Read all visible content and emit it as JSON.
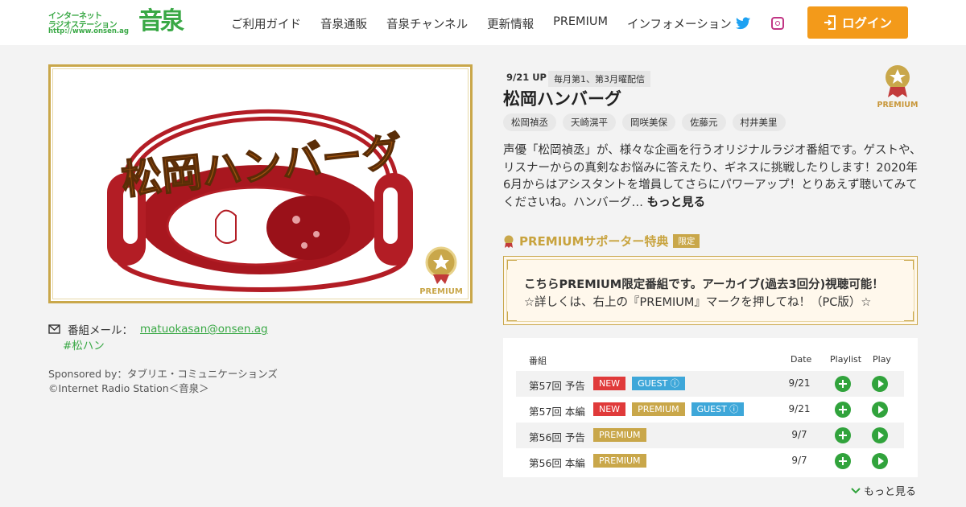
{
  "header": {
    "logo_line1": "インターネット",
    "logo_line2": "ラジオステーション",
    "logo_url": "http://www.onsen.ag",
    "logo_big": "音泉",
    "nav": [
      "ご利用ガイド",
      "音泉通販",
      "音泉チャンネル",
      "更新情報",
      "PREMIUM",
      "インフォメーション"
    ],
    "login_label": "ログイン"
  },
  "program": {
    "art_title": "松岡ハンバーグ",
    "art_badge": "PREMIUM",
    "mail_label": "番組メール：",
    "mail": "matuokasan@onsen.ag",
    "hashtag": "#松ハン",
    "sponsor": "Sponsored by：タブリエ・コミュニケーションズ",
    "copyright": "©Internet Radio Station＜音泉＞",
    "update": "9/21 UP",
    "schedule": "毎月第1、第3月曜配信",
    "title": "松岡ハンバーグ",
    "casts": [
      "松岡禎丞",
      "天崎滉平",
      "岡咲美保",
      "佐藤元",
      "村井美里"
    ],
    "premium_label": "PREMIUM",
    "description": "声優「松岡禎丞」が、様々な企画を行うオリジナルラジオ番組です。ゲストや、リスナーからの真剣なお悩みに答えたり、ギネスに挑戦したりします！2020年6月からはアシスタントを増員してさらにパワーアップ！とりあえず聴いてみてくださいね。ハンバーグ…",
    "more_label": "もっと見る"
  },
  "premium_supporter": {
    "heading": "PREMIUMサポーター特典",
    "limited": "限定",
    "line1": "こちらPREMIUM限定番組です。アーカイブ(過去3回分)視聴可能！",
    "line2": "☆詳しくは、右上の『PREMIUM』マークを押してね！（PC版）☆"
  },
  "episodes": {
    "headers": {
      "episode": "番組",
      "date": "Date",
      "playlist": "Playlist",
      "play": "Play"
    },
    "rows": [
      {
        "title": "第57回 予告",
        "tags": [
          {
            "label": "NEW",
            "kind": "new"
          },
          {
            "label": "GUEST ⓘ",
            "kind": "guest"
          }
        ],
        "date": "9/21"
      },
      {
        "title": "第57回 本編",
        "tags": [
          {
            "label": "NEW",
            "kind": "new"
          },
          {
            "label": "PREMIUM",
            "kind": "premium"
          },
          {
            "label": "GUEST ⓘ",
            "kind": "guest"
          }
        ],
        "date": "9/21"
      },
      {
        "title": "第56回 予告",
        "tags": [
          {
            "label": "PREMIUM",
            "kind": "premium"
          }
        ],
        "date": "9/7"
      },
      {
        "title": "第56回 本編",
        "tags": [
          {
            "label": "PREMIUM",
            "kind": "premium"
          }
        ],
        "date": "9/7"
      }
    ],
    "more_label": "もっと見る"
  },
  "colors": {
    "brand_green": "#39a845",
    "login_orange": "#f39a1a",
    "gold": "#c9a74a",
    "new_red": "#e03a3a",
    "guest_blue": "#3ea7d9"
  }
}
